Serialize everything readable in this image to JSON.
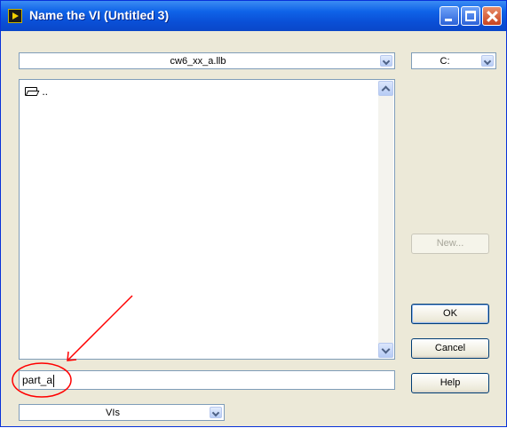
{
  "window": {
    "title": "Name the VI (Untitled 3)"
  },
  "library_select": {
    "value": "cw6_xx_a.llb"
  },
  "drive_select": {
    "value": "C:"
  },
  "file_list": {
    "items": [
      {
        "label": ".."
      }
    ]
  },
  "buttons": {
    "new": "New...",
    "ok": "OK",
    "cancel": "Cancel",
    "help": "Help"
  },
  "name_field": {
    "value": "part_a"
  },
  "filter_select": {
    "value": "VIs"
  },
  "colors": {
    "annotation": "#ff0000",
    "title_bar": "#0a4fd6"
  },
  "icons": [
    "labview-app-icon",
    "minimize-icon",
    "maximize-icon",
    "close-icon",
    "folder-open-icon",
    "chevron-down-icon",
    "scroll-up-icon",
    "scroll-down-icon"
  ]
}
